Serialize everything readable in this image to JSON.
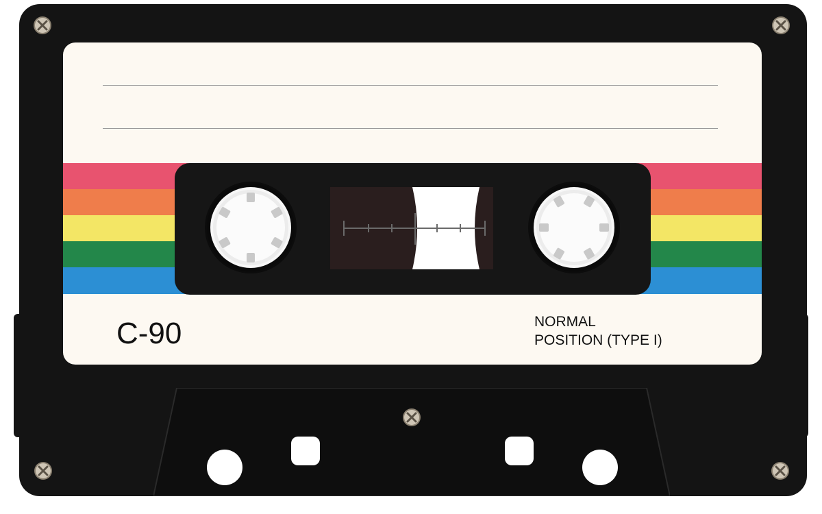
{
  "cassette": {
    "tape_length": "C-90",
    "tape_type_line1": "NORMAL",
    "tape_type_line2": "POSITION (TYPE I)"
  },
  "colors": {
    "shell": "#141414",
    "label_background": "#fdf9f2",
    "stripes": [
      "#e8536f",
      "#ef7d4b",
      "#f3e665",
      "#23874a",
      "#2c8fd4"
    ]
  }
}
